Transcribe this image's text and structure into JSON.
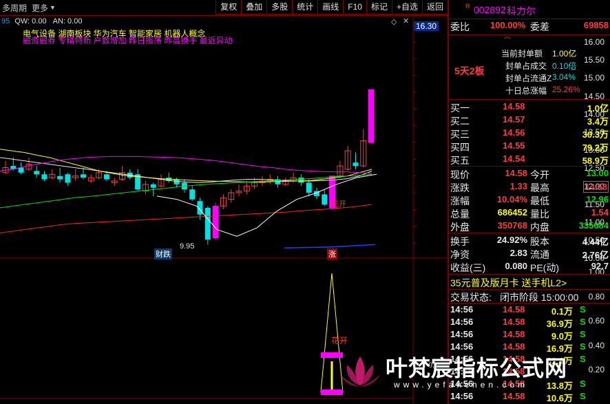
{
  "topbar": {
    "period": "多周期",
    "more": "更多",
    "buttons": [
      "复权",
      "叠加",
      "多股",
      "统计",
      "画线",
      "F10",
      "标记",
      "+自选",
      "返回"
    ]
  },
  "indicators": {
    "prefix": "95",
    "qw": "QW: 0.00",
    "an": "AN: 0.00",
    "concepts": "电气设备  湖南板块  华为汽车 智能家居 机器人概念",
    "tags": "融资融券 专精特新 户数增加 昨日振荡 昨高换手 最近异动"
  },
  "chart": {
    "price_axis": [
      "16.00",
      "15.50",
      "15.00",
      "14.50",
      "14.00",
      "13.50",
      "13.00",
      "12.50",
      "12.00",
      "11.50",
      "11.00",
      "10.50",
      "10.00"
    ],
    "current_price_tag": "16.30",
    "low_label": "9.95",
    "tag_caidie": "财跌",
    "tag_huakai": "花开",
    "tag_zhang": "涨",
    "sub_axis": [
      "1.00",
      "0.80",
      "0.60",
      "0.40",
      "0.20"
    ],
    "sub_tag": "花开",
    "sub_x_label": "0.2"
  },
  "quote": {
    "code_prefix": "R",
    "code": "002892",
    "name": "科力尔",
    "weibi_label": "委比",
    "weibi": "100.00%",
    "weicha_label": "委差",
    "weicha": "69858",
    "streak": "5天2板",
    "seal_amount_label": "当前封单额",
    "seal_amount": "1.00亿",
    "seal_turnover_label": "封单占成交",
    "seal_turnover": "0.10倍",
    "seal_float_label": "封单占流通Z",
    "seal_float": "3.04%",
    "ten_day_label": "十日总涨幅",
    "ten_day": "25.26%",
    "bids": [
      {
        "label": "买一",
        "price": "14.58",
        "vol": "1.0亿"
      },
      {
        "label": "买二",
        "price": "14.57",
        "vol": "3.4万"
      },
      {
        "label": "买三",
        "price": "14.56",
        "vol": "30.3万"
      },
      {
        "label": "买四",
        "price": "14.55",
        "vol": "79.2万"
      },
      {
        "label": "买五",
        "price": "14.54",
        "vol": "58.9万"
      }
    ],
    "stats": [
      {
        "l1": "现价",
        "v1": "14.58",
        "l2": "今开",
        "v2": "13.00"
      },
      {
        "l1": "涨跌",
        "v1": "1.33",
        "l2": "最高",
        "v2": "14.58"
      },
      {
        "l1": "涨幅",
        "v1": "10.04%",
        "l2": "最低",
        "v2": "12.96"
      },
      {
        "l1": "总量",
        "v1": "686452",
        "l2": "量比",
        "v2": "1.54"
      },
      {
        "l1": "外盘",
        "v1": "350768",
        "l2": "内盘",
        "v2": "335684"
      }
    ],
    "fin": [
      {
        "l1": "换手",
        "v1": "24.92%",
        "l2": "股本",
        "v2": "4.44亿"
      },
      {
        "l1": "净资",
        "v1": "2.83",
        "l2": "流通",
        "v2": "2.76亿"
      },
      {
        "l1": "收益(三)",
        "v1": "0.080",
        "l2": "PE(动)",
        "v2": "92.7"
      }
    ],
    "promo": "35元普及版月卡 送手机L2>",
    "status_label": "交易状态:",
    "status": "闭市阶段 15:00:00",
    "ticks": [
      {
        "time": "14:56",
        "price": "14.58",
        "vol": "0.1万",
        "side": "S"
      },
      {
        "time": "14:56",
        "price": "14.58",
        "vol": "36.9万",
        "side": "S"
      },
      {
        "time": "14:56",
        "price": "14.58",
        "vol": "9.0万",
        "side": "S"
      },
      {
        "time": "14:56",
        "price": "14.58",
        "vol": "16.9万",
        "side": "S"
      },
      {
        "time": "14:56",
        "price": "14.58",
        "vol": "31.8万",
        "side": "S"
      },
      {
        "time": "14:56",
        "price": "14.58",
        "vol": "",
        "side": ""
      },
      {
        "time": "14:56",
        "price": "14.58",
        "vol": "13.8万",
        "side": "S"
      },
      {
        "time": "14:56",
        "price": "14.58",
        "vol": "10.6万",
        "side": "S"
      }
    ]
  },
  "watermark": {
    "text": "叶梵宸指标公式网",
    "url": "www.yefanchen.com"
  },
  "colors": {
    "up": "#ff3c3c",
    "down": "#00e0e0",
    "bg": "#000000",
    "grid": "#800000"
  }
}
